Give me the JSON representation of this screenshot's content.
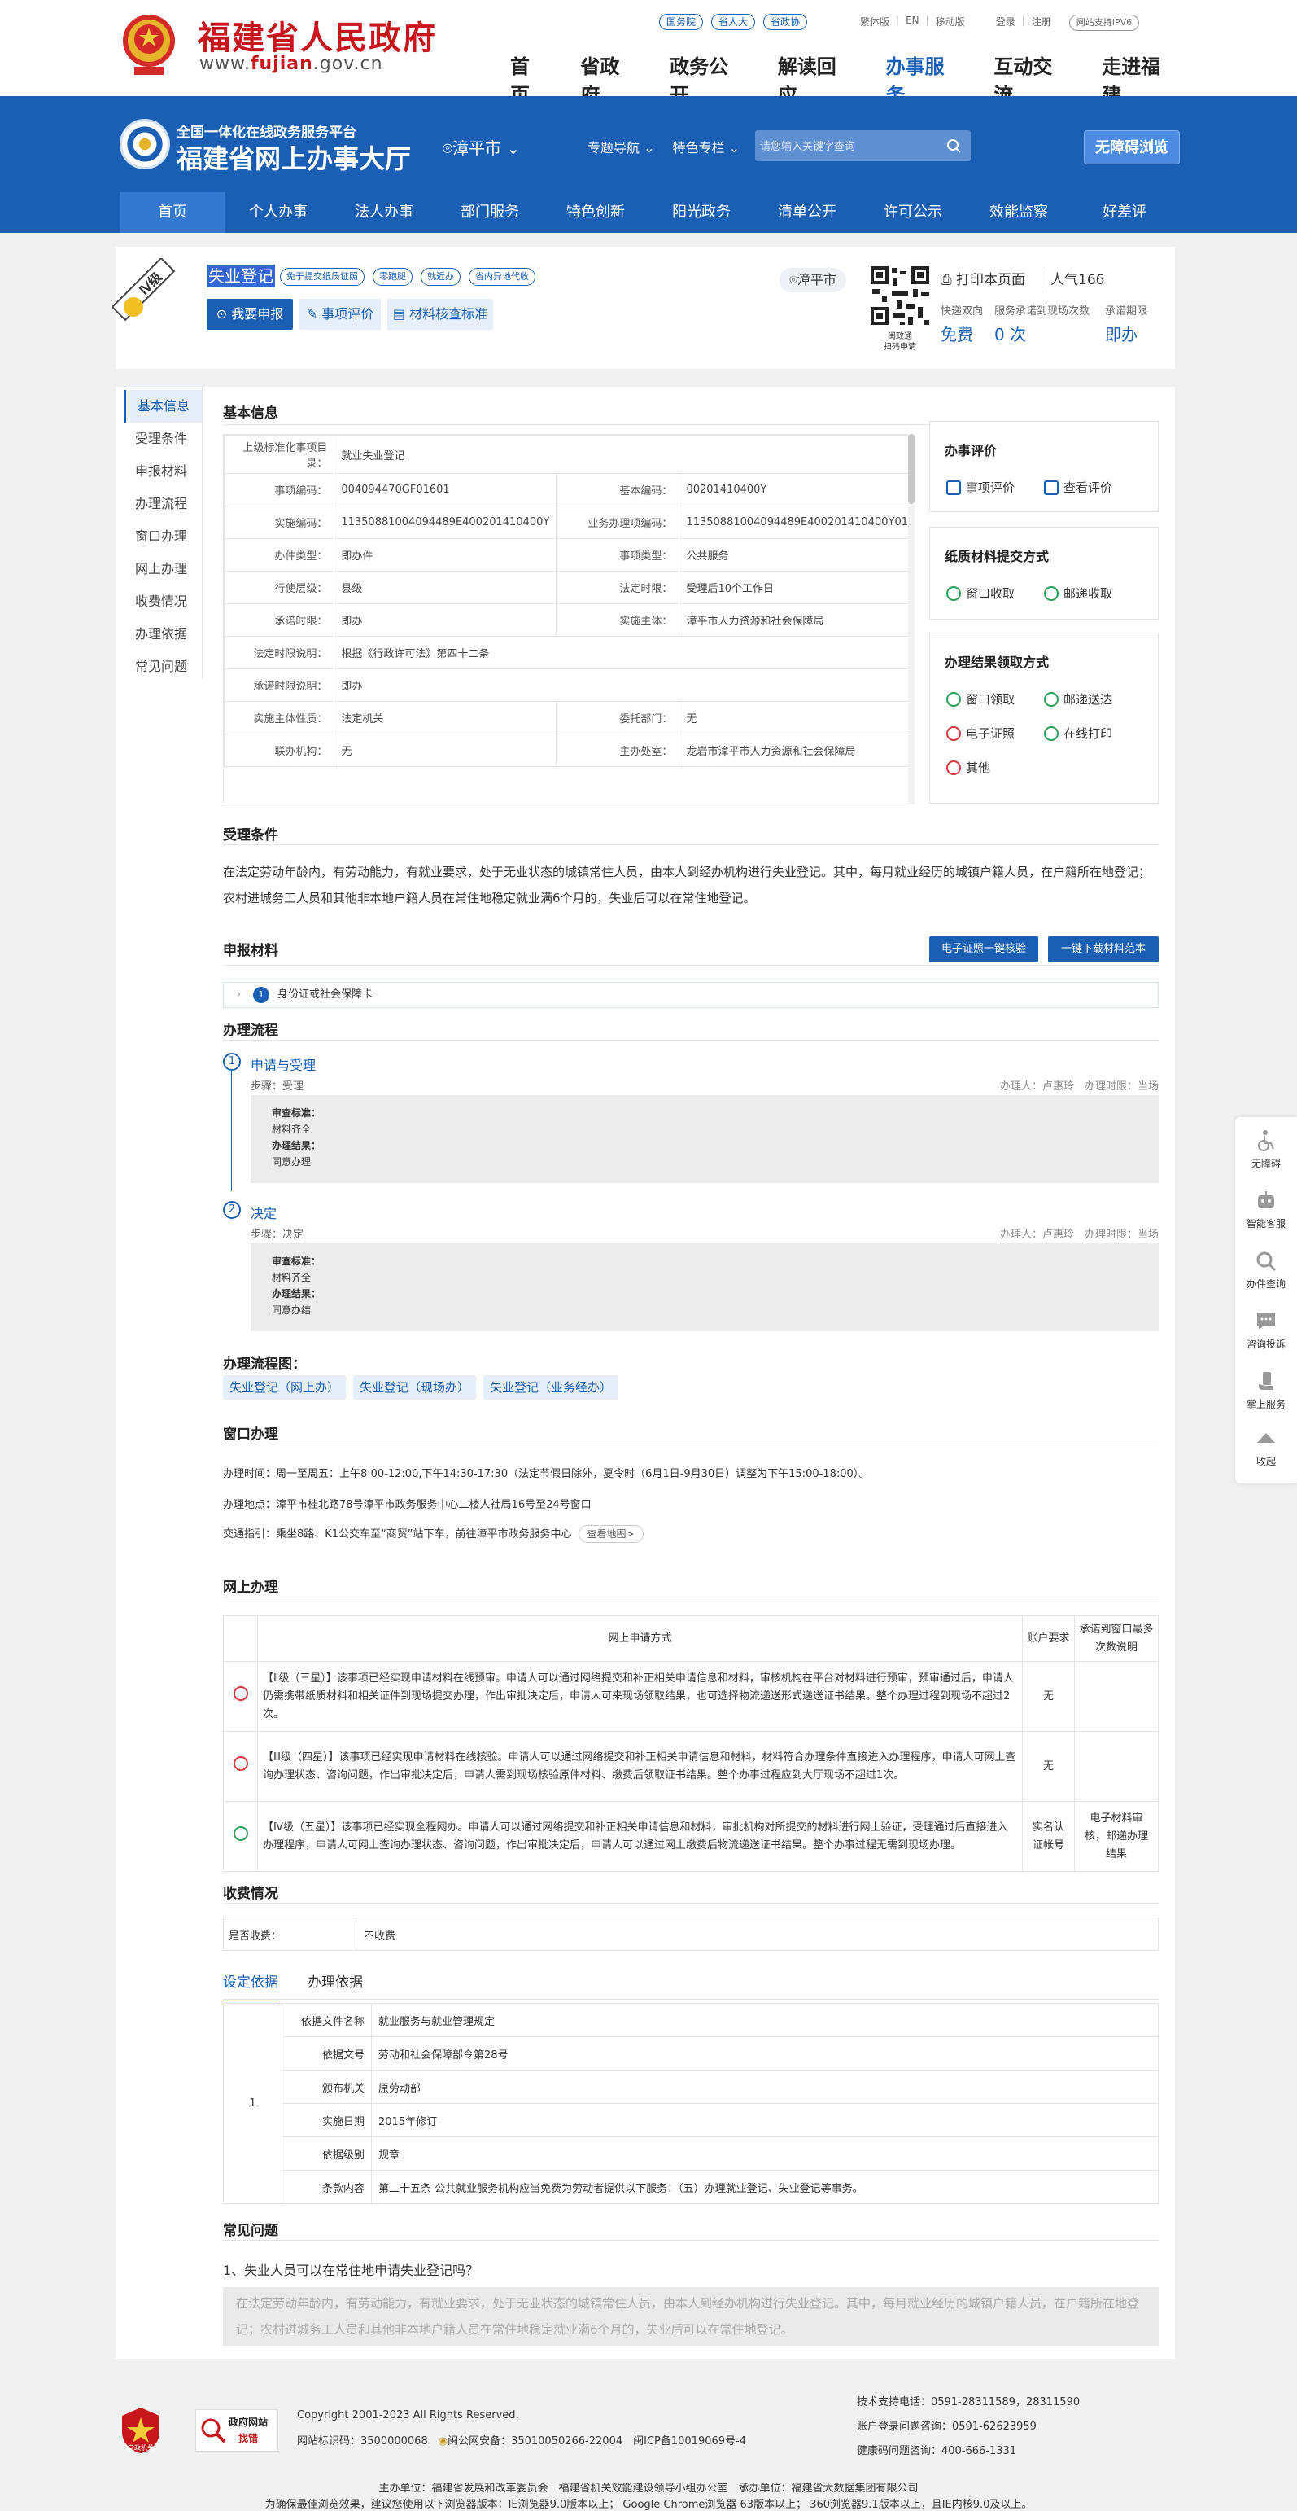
{
  "gov_header": {
    "site_title": "福建省人民政府",
    "site_domain_prefix": "www.",
    "site_domain_brand": "fujian",
    "site_domain_suffix": ".gov.cn",
    "pill_links": [
      "国务院",
      "省人大",
      "省政协"
    ],
    "util_links": [
      "繁体版",
      "EN",
      "移动版",
      "登录",
      "注册"
    ],
    "ipv6": "网站支持IPV6",
    "nav": [
      "首页",
      "省政府",
      "政务公开",
      "解读回应",
      "办事服务",
      "互动交流",
      "走进福建"
    ],
    "nav_active": "办事服务"
  },
  "hall": {
    "subtitle": "全国一体化在线政务服务平台",
    "title": "福建省网上办事大厅",
    "city": "漳平市",
    "nav": [
      "专题导航",
      "特色专栏"
    ],
    "search_placeholder": "请您输入关键字查询",
    "barrier_free": "无障碍浏览",
    "subnav": [
      "首页",
      "个人办事",
      "法人办事",
      "部门服务",
      "特色创新",
      "阳光政务",
      "清单公开",
      "许可公示",
      "效能监察",
      "好差评"
    ]
  },
  "item": {
    "level": "Ⅳ级",
    "name": "失业登记",
    "tags": [
      "免于提交纸质证照",
      "零跑腿",
      "就近办",
      "省内异地代收"
    ],
    "apply": "我要申报",
    "evaluate": "事项评价",
    "check_standard": "材料核查标准",
    "location": "漳平市",
    "qr_caption_1": "闽政通",
    "qr_caption_2": "扫码申请",
    "print": "打印本页面",
    "popularity": "人气166",
    "stats": [
      {
        "label": "快递双向",
        "value": "免费"
      },
      {
        "label": "服务承诺到现场次数",
        "value": "0 次"
      },
      {
        "label": "承诺期限",
        "value": "即办"
      }
    ]
  },
  "side_nav": [
    "基本信息",
    "受理条件",
    "申报材料",
    "办理流程",
    "窗口办理",
    "网上办理",
    "收费情况",
    "办理依据",
    "常见问题"
  ],
  "basic_info": {
    "title": "基本信息",
    "rows": [
      {
        "k1": "上级标准化事项目录：",
        "v1": "就业失业登记"
      },
      {
        "k1": "事项编码：",
        "v1": "004094470GF01601",
        "k2": "基本编码：",
        "v2": "00201410400Y"
      },
      {
        "k1": "实施编码：",
        "v1": "11350881004094489E400201410400Y",
        "k2": "业务办理项编码：",
        "v2": "11350881004094489E400201410400Y01"
      },
      {
        "k1": "办件类型：",
        "v1": "即办件",
        "k2": "事项类型：",
        "v2": "公共服务"
      },
      {
        "k1": "行使层级：",
        "v1": "县级",
        "k2": "法定时限：",
        "v2": "受理后10个工作日"
      },
      {
        "k1": "承诺时限：",
        "v1": "即办",
        "k2": "实施主体：",
        "v2": "漳平市人力资源和社会保障局"
      },
      {
        "k1": "法定时限说明：",
        "v1": "根据《行政许可法》第四十二条"
      },
      {
        "k1": "承诺时限说明：",
        "v1": "即办"
      },
      {
        "k1": "实施主体性质：",
        "v1": "法定机关",
        "k2": "委托部门：",
        "v2": "无"
      },
      {
        "k1": "联办机构：",
        "v1": "无",
        "k2": "主办处室：",
        "v2": "龙岩市漳平市人力资源和社会保障局"
      }
    ]
  },
  "panels": {
    "evaluation": {
      "title": "办事评价",
      "items": [
        "事项评价",
        "查看评价"
      ]
    },
    "submission": {
      "title": "纸质材料提交方式",
      "items": [
        "窗口收取",
        "邮递收取"
      ]
    },
    "result": {
      "title": "办理结果领取方式",
      "items": [
        "窗口领取",
        "邮递送达",
        "电子证照",
        "在线打印",
        "其他"
      ]
    }
  },
  "conditions": {
    "title": "受理条件",
    "text": "在法定劳动年龄内，有劳动能力，有就业要求，处于无业状态的城镇常住人员，由本人到经办机构进行失业登记。其中，每月就业经历的城镇户籍人员，在户籍所在地登记；农村进城务工人员和其他非本地户籍人员在常住地稳定就业满6个月的，失业后可以在常住地登记。"
  },
  "materials": {
    "title": "申报材料",
    "btn_verify": "电子证照一键核验",
    "btn_download": "一键下载材料范本",
    "items": [
      {
        "no": "1",
        "name": "身份证或社会保障卡"
      }
    ]
  },
  "process": {
    "title": "办理流程",
    "steps": [
      {
        "no": "1",
        "name": "申请与受理",
        "step": "步骤：受理",
        "handler": "办理人：卢惠玲",
        "time": "办理时限：当场",
        "std_label": "审查标准：",
        "std": "材料齐全",
        "res_label": "办理结果：",
        "res": "同意办理"
      },
      {
        "no": "2",
        "name": "决定",
        "step": "步骤：决定",
        "handler": "办理人：卢惠玲",
        "time": "办理时限：当场",
        "std_label": "审查标准：",
        "std": "材料齐全",
        "res_label": "办理结果：",
        "res": "同意办结"
      }
    ],
    "chart_title": "办理流程图：",
    "charts": [
      "失业登记（网上办）",
      "失业登记（现场办）",
      "失业登记（业务经办）"
    ]
  },
  "window": {
    "title": "窗口办理",
    "time": "办理时间：周一至周五：上午8:00-12:00,下午14:30-17:30（法定节假日除外，夏令时（6月1日-9月30日）调整为下午15:00-18:00）。",
    "address": "办理地点：漳平市桂北路78号漳平市政务服务中心二楼人社局16号至24号窗口",
    "traffic": "交通指引：乘坐8路、K1公交车至“商贸”站下车，前往漳平市政务服务中心",
    "map": "查看地图>"
  },
  "online": {
    "title": "网上办理",
    "headers": [
      "网上申请方式",
      "账户要求",
      "承诺到窗口最多次数说明"
    ],
    "rows": [
      {
        "ok": false,
        "desc": "【Ⅱ级（三星）】该事项已经实现申请材料在线预审。申请人可以通过网络提交和补正相关申请信息和材料，审核机构在平台对材料进行预审，预审通过后，申请人仍需携带纸质材料和相关证件到现场提交办理，作出审批决定后，申请人可来现场领取结果，也可选择物流递送形式递送证书结果。整个办理过程到现场不超过2次。",
        "account": "无",
        "count": ""
      },
      {
        "ok": false,
        "desc": "【Ⅲ级（四星）】该事项已经实现申请材料在线核验。申请人可以通过网络提交和补正相关申请信息和材料，材料符合办理条件直接进入办理程序，申请人可网上查询办理状态、咨询问题，作出审批决定后，申请人需到现场核验原件材料、缴费后领取证书结果。整个办事过程应到大厅现场不超过1次。",
        "account": "无",
        "count": ""
      },
      {
        "ok": true,
        "desc": "【Ⅳ级（五星）】该事项已经实现全程网办。申请人可以通过网络提交和补正相关申请信息和材料，审批机构对所提交的材料进行网上验证，受理通过后直接进入办理程序，申请人可网上查询办理状态、咨询问题，作出审批决定后，申请人可以通过网上缴费后物流递送证书结果。整个办事过程无需到现场办理。",
        "account": "实名认证帐号",
        "count": "电子材料审核，邮递办理结果"
      }
    ]
  },
  "fee": {
    "title": "收费情况",
    "label": "是否收费：",
    "value": "不收费"
  },
  "basis": {
    "tabs": [
      "设定依据",
      "办理依据"
    ],
    "index": "1",
    "rows": [
      {
        "k": "依据文件名称",
        "v": "就业服务与就业管理规定"
      },
      {
        "k": "依据文号",
        "v": "劳动和社会保障部令第28号"
      },
      {
        "k": "颁布机关",
        "v": "原劳动部"
      },
      {
        "k": "实施日期",
        "v": "2015年修订"
      },
      {
        "k": "依据级别",
        "v": "规章"
      },
      {
        "k": "条款内容",
        "v": "第二十五条 公共就业服务机构应当免费为劳动者提供以下服务：（五）办理就业登记、失业登记等事务。"
      }
    ]
  },
  "faq": {
    "title": "常见问题",
    "q": "1、失业人员可以在常住地申请失业登记吗？",
    "a": "在法定劳动年龄内，有劳动能力，有就业要求，处于无业状态的城镇常住人员，由本人到经办机构进行失业登记。其中，每月就业经历的城镇户籍人员，在户籍所在地登记；农村进城务工人员和其他非本地户籍人员在常住地稳定就业满6个月的，失业后可以在常住地登记。"
  },
  "side_tools": [
    "无障碍",
    "智能客服",
    "办件查询",
    "咨询投诉",
    "掌上服务",
    "收起"
  ],
  "footer": {
    "badge1": "党政机关",
    "badge2_line1": "政府网站",
    "badge2_line2": "找错",
    "copyright": "Copyright 2001-2023 All Rights Reserved.",
    "site_id": "网站标识码：3500000068",
    "police": "闽公网安备：35010050266-22004",
    "icp": "闽ICP备10019069号-4",
    "tech_phone": "技术支持电话：0591-28311589，28311590",
    "account_phone": "账户登录问题咨询：0591-62623959",
    "health_phone": "健康码问题咨询：400-666-1331",
    "host": "主办单位：福建省发展和改革委员会　福建省机关效能建设领导小组办公室　承办单位：福建省大数据集团有限公司",
    "browser": "为确保最佳浏览效果，建议您使用以下浏览器版本：IE浏览器9.0版本以上； Google Chrome浏览器 63版本以上； 360浏览器9.1版本以上，且IE内核9.0及以上。"
  }
}
